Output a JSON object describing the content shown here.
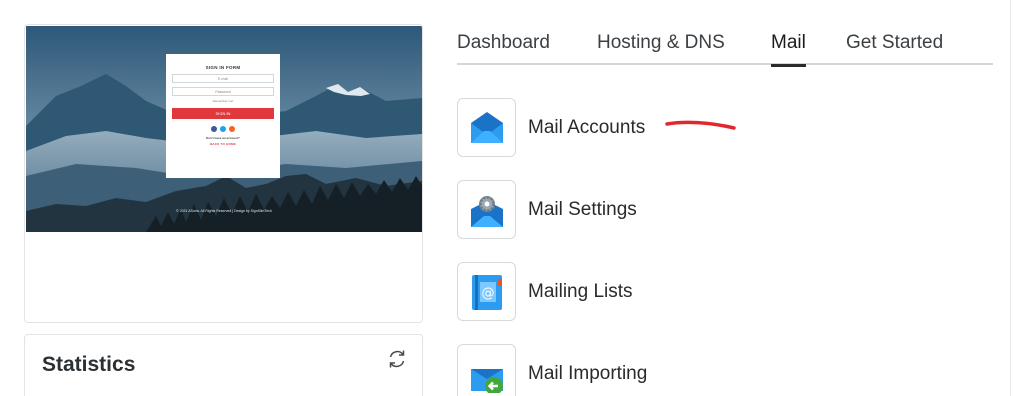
{
  "preview": {
    "form_title": "SIGN IN FORM",
    "email_placeholder": "E-mail",
    "password_placeholder": "Password",
    "remember_label": "Remember me!",
    "signin_button": "SIGN IN",
    "no_account": "Don't have an account?",
    "back_link": "BACK TO HOME",
    "footer": "© 2021 ASuria. All Rights Reserved | Design by SignSlimTech",
    "colors": {
      "sky": "#2d5878",
      "button": "#e0383d"
    }
  },
  "statistics": {
    "title": "Statistics",
    "refresh_icon": "refresh-icon"
  },
  "tabs": [
    {
      "label": "Dashboard",
      "active": false
    },
    {
      "label": "Hosting & DNS",
      "active": false
    },
    {
      "label": "Mail",
      "active": true
    },
    {
      "label": "Get Started",
      "active": false
    }
  ],
  "mail_items": [
    {
      "label": "Mail Accounts",
      "icon": "envelope-icon"
    },
    {
      "label": "Mail Settings",
      "icon": "envelope-gear-icon"
    },
    {
      "label": "Mailing Lists",
      "icon": "address-book-icon"
    },
    {
      "label": "Mail Importing",
      "icon": "envelope-import-icon"
    }
  ],
  "annotation": {
    "color": "#e0282e"
  }
}
